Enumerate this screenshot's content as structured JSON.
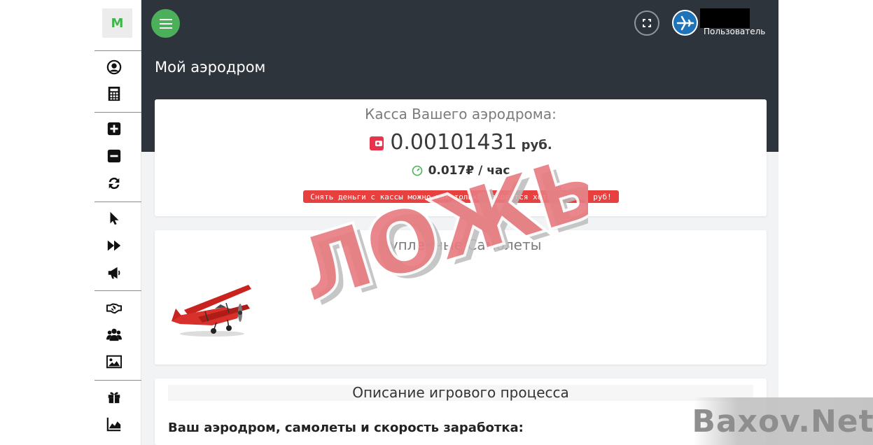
{
  "sidebar": {
    "logo": "M",
    "icons": [
      "user-circle-icon",
      "calculator-icon",
      "plus-square-icon",
      "minus-square-icon",
      "refresh-icon",
      "pointer-icon",
      "fast-forward-icon",
      "megaphone-icon",
      "handshake-icon",
      "users-icon",
      "image-icon",
      "gift-icon",
      "area-chart-icon"
    ]
  },
  "header": {
    "title": "Мой аэродром",
    "user_role": "Пользователь"
  },
  "cashbox": {
    "title": "Касса Вашего аэродрома:",
    "value": "0.00101431",
    "unit": "руб.",
    "rate": "0.017₽ / час",
    "alert": "Снять деньги с кассы можно как только накопится хотя бы 0.01 руб!"
  },
  "planes": {
    "title": "Купленные Самолеты"
  },
  "description": {
    "title": "Описание игрового процесса",
    "subtitle": "Ваш аэродром, самолеты и скорость заработка:"
  },
  "overlays": {
    "stamp": "ЛОЖЬ",
    "watermark": "Baxov.Net"
  },
  "colors": {
    "header_bg": "#2e343b",
    "accent_green": "#4cb05a",
    "alert_red": "#e8403f",
    "wallet_red": "#e8334a"
  }
}
